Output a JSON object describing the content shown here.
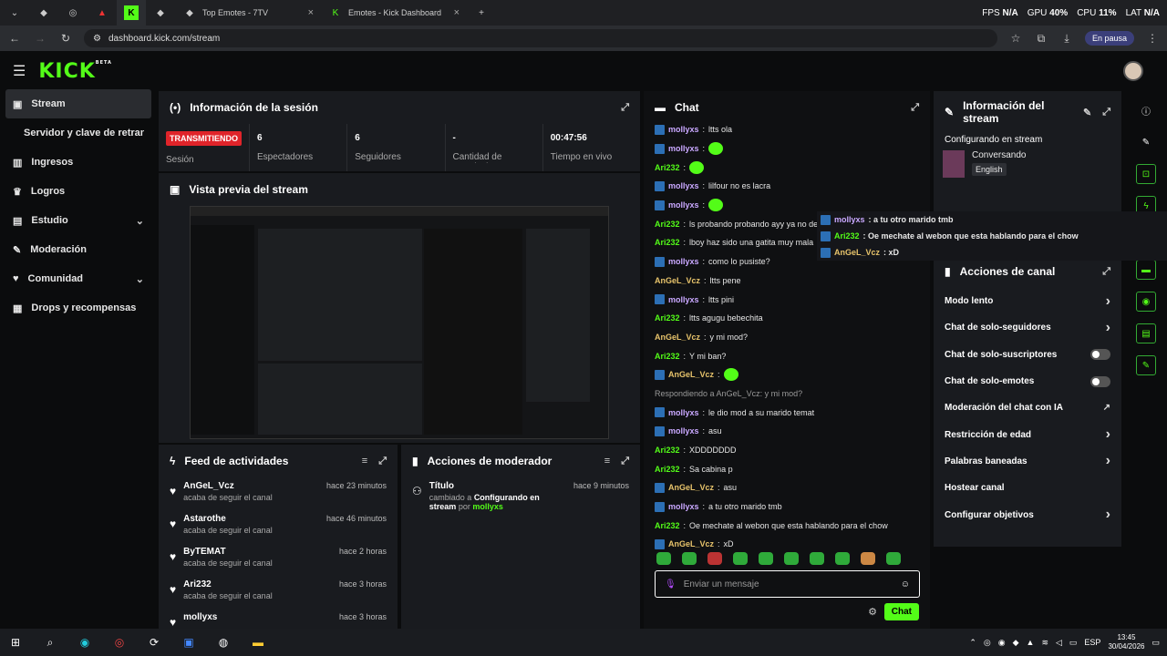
{
  "browser": {
    "tabs": [
      {
        "label": ""
      },
      {
        "label": ""
      },
      {
        "label": ""
      },
      {
        "label": ""
      },
      {
        "label": ""
      },
      {
        "label": ""
      },
      {
        "label": "Top Emotes - 7TV"
      },
      {
        "label": "Emotes - Kick Dashboard"
      }
    ],
    "url": "dashboard.kick.com/stream",
    "pause_label": "En pausa",
    "perf": {
      "fps_label": "FPS",
      "fps": "N/A",
      "gpu_label": "GPU",
      "gpu": "40%",
      "cpu_label": "CPU",
      "cpu": "11%",
      "lat_label": "LAT",
      "lat": "N/A"
    }
  },
  "header": {
    "logo": "KICK",
    "beta": "BETA"
  },
  "sidebar": {
    "items": [
      {
        "label": "Stream"
      },
      {
        "label": "Servidor y clave de retransm"
      },
      {
        "label": "Ingresos"
      },
      {
        "label": "Logros"
      },
      {
        "label": "Estudio"
      },
      {
        "label": "Moderación"
      },
      {
        "label": "Comunidad"
      },
      {
        "label": "Drops y recompensas"
      }
    ]
  },
  "session": {
    "title": "Información de la sesión",
    "status": "TRANSMITIENDO",
    "status_label": "Sesión",
    "stats": [
      {
        "value": "6",
        "label": "Espectadores"
      },
      {
        "value": "6",
        "label": "Seguidores"
      },
      {
        "value": "-",
        "label": "Cantidad de suscripciones"
      },
      {
        "value": "00:47:56",
        "label": "Tiempo en vivo"
      }
    ]
  },
  "preview": {
    "title": "Vista previa del stream"
  },
  "feed": {
    "title": "Feed de actividades",
    "items": [
      {
        "name": "AnGeL_Vcz",
        "sub": "acaba de seguir el canal",
        "time": "hace 23 minutos"
      },
      {
        "name": "Astarothe",
        "sub": "acaba de seguir el canal",
        "time": "hace 46 minutos"
      },
      {
        "name": "ByTEMAT",
        "sub": "acaba de seguir el canal",
        "time": "hace 2 horas"
      },
      {
        "name": "Ari232",
        "sub": "acaba de seguir el canal",
        "time": "hace 3 horas"
      },
      {
        "name": "mollyxs",
        "sub": "",
        "time": "hace 3 horas"
      }
    ]
  },
  "modactions": {
    "title": "Acciones de moderador",
    "item": {
      "name": "Título",
      "time": "hace 9 minutos",
      "pre": "cambiado a",
      "target": "Configurando en stream",
      "by": "por",
      "user": "mollyxs"
    }
  },
  "chat": {
    "title": "Chat",
    "messages": [
      {
        "user": "mollyxs",
        "text": "ltts ola",
        "color": "#c9a8ff",
        "badge": true
      },
      {
        "user": "mollyxs",
        "text": "",
        "color": "#c9a8ff",
        "badge": true,
        "emoji": true
      },
      {
        "user": "Ari232",
        "text": "",
        "color": "#53fc18",
        "badge": false,
        "emoji": true
      },
      {
        "user": "mollyxs",
        "text": "lilfour no es lacra",
        "color": "#c9a8ff",
        "badge": true
      },
      {
        "user": "mollyxs",
        "text": "",
        "color": "#c9a8ff",
        "badge": true,
        "emoji": true
      },
      {
        "user": "Ari232",
        "text": "ls probando probando ayy ya no de hablo mao",
        "color": "#53fc18",
        "badge": false
      },
      {
        "user": "Ari232",
        "text": "lboy haz sido una gatita muy mala",
        "color": "#53fc18",
        "badge": false
      },
      {
        "user": "mollyxs",
        "text": "como lo pusiste?",
        "color": "#c9a8ff",
        "badge": true
      },
      {
        "user": "AnGeL_Vcz",
        "text": "ltts pene",
        "color": "#e7c36b",
        "badge": false
      },
      {
        "user": "mollyxs",
        "text": "ltts pini",
        "color": "#c9a8ff",
        "badge": true
      },
      {
        "user": "Ari232",
        "text": "ltts agugu bebechita",
        "color": "#53fc18",
        "badge": false
      },
      {
        "user": "AnGeL_Vcz",
        "text": "y mi mod?",
        "color": "#e7c36b",
        "badge": false
      },
      {
        "user": "Ari232",
        "text": "Y mi ban?",
        "color": "#53fc18",
        "badge": false
      },
      {
        "user": "AnGeL_Vcz",
        "text": "",
        "color": "#e7c36b",
        "badge": true,
        "emoji": true
      },
      {
        "user": "",
        "text": "Respondiendo a AnGeL_Vcz: y mi mod?",
        "color": "#999",
        "badge": false,
        "reply": true
      },
      {
        "user": "mollyxs",
        "text": "le dio mod a su marido temat",
        "color": "#c9a8ff",
        "badge": true
      },
      {
        "user": "mollyxs",
        "text": "asu",
        "color": "#c9a8ff",
        "badge": true
      },
      {
        "user": "Ari232",
        "text": "XDDDDDDD",
        "color": "#53fc18",
        "badge": false
      },
      {
        "user": "Ari232",
        "text": "Sa cabina p",
        "color": "#53fc18",
        "badge": false
      },
      {
        "user": "AnGeL_Vcz",
        "text": "asu",
        "color": "#e7c36b",
        "badge": true
      },
      {
        "user": "mollyxs",
        "text": "a tu otro marido tmb",
        "color": "#c9a8ff",
        "badge": true
      },
      {
        "user": "Ari232",
        "text": "Oe mechate al webon que esta hablando para el chow",
        "color": "#53fc18",
        "badge": false
      },
      {
        "user": "AnGeL_Vcz",
        "text": "xD",
        "color": "#e7c36b",
        "badge": true
      }
    ],
    "input_placeholder": "Enviar un mensaje",
    "send_label": "Chat"
  },
  "overlay": [
    {
      "user": "mollyxs",
      "text": ": a tu otro marido tmb",
      "color": "#c9a8ff"
    },
    {
      "user": "Ari232",
      "text": ": Oe mechate al webon que esta hablando para el chow",
      "color": "#53fc18"
    },
    {
      "user": "AnGeL_Vcz",
      "text": ": xD",
      "color": "#e7c36b"
    }
  ],
  "streaminfo": {
    "title": "Información del stream",
    "category_heading": "Configurando en stream",
    "category": "Conversando",
    "language": "English"
  },
  "channel_actions": {
    "title": "Acciones de canal",
    "items": [
      {
        "label": "Modo lento",
        "control": "chevron"
      },
      {
        "label": "Chat de solo-seguidores",
        "control": "chevron"
      },
      {
        "label": "Chat de solo-suscriptores",
        "control": "toggle"
      },
      {
        "label": "Chat de solo-emotes",
        "control": "toggle"
      },
      {
        "label": "Moderación del chat con IA",
        "control": "external"
      },
      {
        "label": "Restricción de edad",
        "control": "chevron"
      },
      {
        "label": "Palabras baneadas",
        "control": "chevron"
      },
      {
        "label": "Hostear canal",
        "control": "none"
      },
      {
        "label": "Configurar objetivos",
        "control": "chevron"
      }
    ]
  },
  "taskbar": {
    "lang": "ESP",
    "time": "13:45",
    "date": "30/04/2026"
  },
  "colors": {
    "accent": "#53fc18",
    "live": "#e0242a",
    "panel": "#191b1f"
  }
}
